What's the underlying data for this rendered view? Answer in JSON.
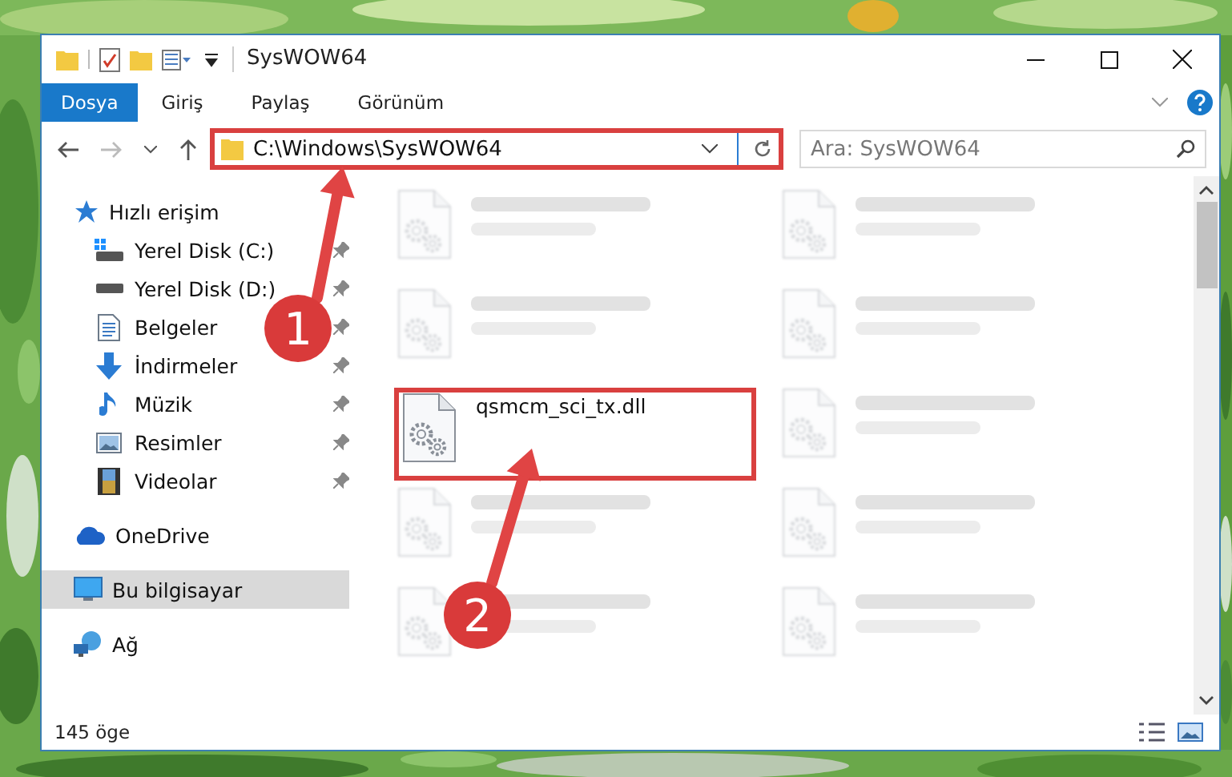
{
  "window": {
    "title": "SysWOW64"
  },
  "ribbon": {
    "tabs": [
      {
        "label": "Dosya",
        "selected": true
      },
      {
        "label": "Giriş",
        "selected": false
      },
      {
        "label": "Paylaş",
        "selected": false
      },
      {
        "label": "Görünüm",
        "selected": false
      }
    ]
  },
  "address_bar": {
    "path": "C:\\Windows\\SysWOW64",
    "highlighted": true
  },
  "search": {
    "placeholder": "Ara: SysWOW64"
  },
  "sidebar": {
    "items": [
      {
        "label": "Hızlı erişim",
        "selected": false,
        "children": [
          {
            "label": "Yerel Disk (C:)",
            "pinned": true
          },
          {
            "label": "Yerel Disk (D:)",
            "pinned": true
          },
          {
            "label": "Belgeler",
            "pinned": true
          },
          {
            "label": "İndirmeler",
            "pinned": true
          },
          {
            "label": "Müzik",
            "pinned": true
          },
          {
            "label": "Resimler",
            "pinned": true
          },
          {
            "label": "Videolar",
            "pinned": true
          }
        ]
      },
      {
        "label": "OneDrive",
        "selected": false
      },
      {
        "label": "Bu bilgisayar",
        "selected": true
      },
      {
        "label": "Ağ",
        "selected": false
      }
    ]
  },
  "files": [
    {
      "kind": "blurred",
      "highlighted": false
    },
    {
      "kind": "blurred",
      "highlighted": false
    },
    {
      "kind": "blurred",
      "highlighted": false
    },
    {
      "kind": "blurred",
      "highlighted": false
    },
    {
      "kind": "file",
      "name": "qsmcm_sci_tx.dll",
      "highlighted": true
    },
    {
      "kind": "blurred",
      "highlighted": false
    },
    {
      "kind": "blurred",
      "highlighted": false
    },
    {
      "kind": "blurred",
      "highlighted": false
    },
    {
      "kind": "blurred",
      "highlighted": false
    },
    {
      "kind": "blurred",
      "highlighted": false
    }
  ],
  "status_bar": {
    "count": "145 öge"
  },
  "annotations": [
    {
      "label": "1"
    },
    {
      "label": "2"
    }
  ]
}
